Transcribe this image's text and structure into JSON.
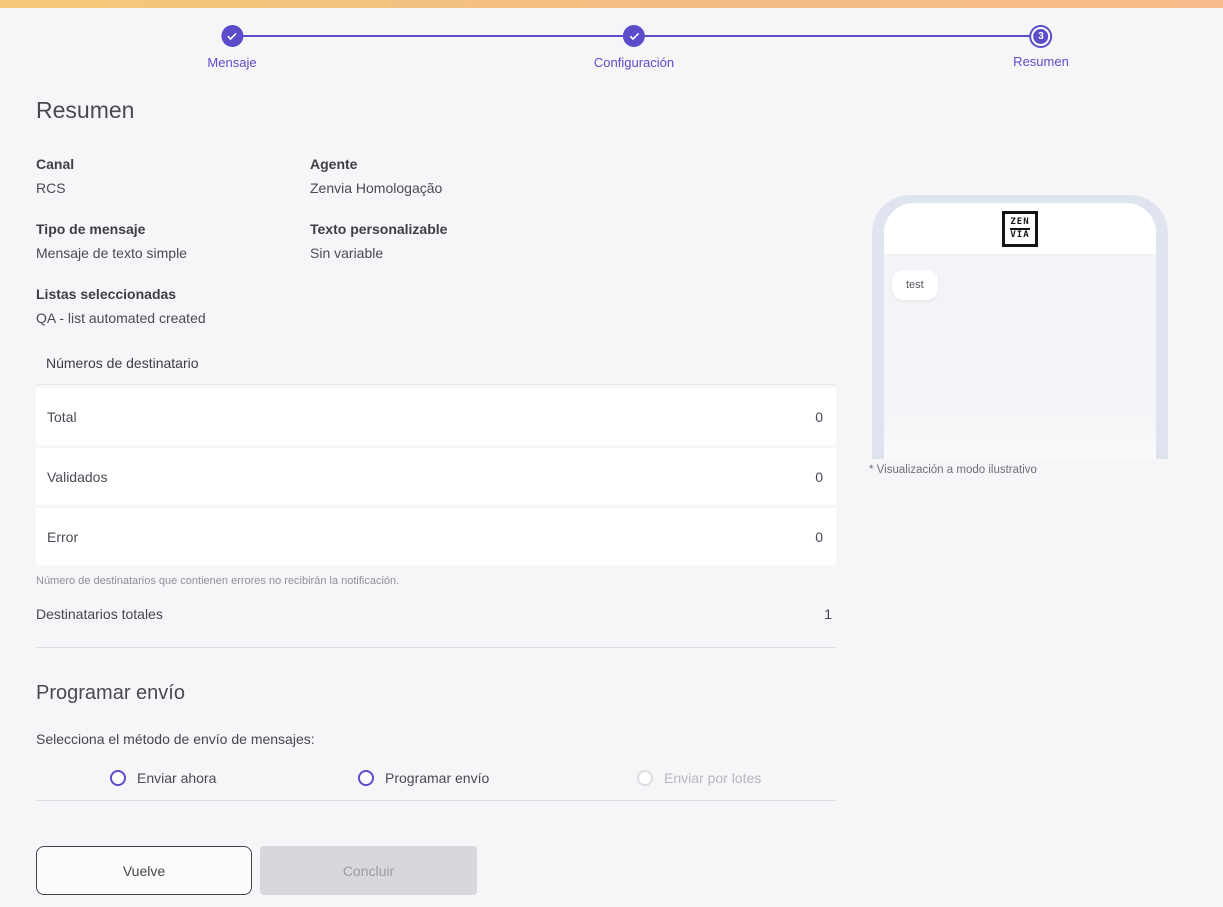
{
  "colors": {
    "accent": "#5b4dc9",
    "topbar_gradient_start": "#f5c979",
    "topbar_gradient_end": "#f8bd8c",
    "disabled_button_bg": "#d6d8db"
  },
  "stepper": {
    "steps": [
      {
        "label": "Mensaje",
        "state": "completed"
      },
      {
        "label": "Configuración",
        "state": "completed"
      },
      {
        "label": "Resumen",
        "state": "current",
        "number": "3"
      }
    ]
  },
  "summary": {
    "title": "Resumen",
    "fields": [
      {
        "label": "Canal",
        "value": "RCS"
      },
      {
        "label": "Agente",
        "value": "Zenvia Homologação"
      },
      {
        "label": "Tipo de mensaje",
        "value": "Mensaje de texto simple"
      },
      {
        "label": "Texto personalizable",
        "value": "Sin variable"
      },
      {
        "label": "Listas seleccionadas",
        "value": "QA - list automated created"
      }
    ],
    "recipients_table": {
      "header": "Números de destinatario",
      "rows": [
        {
          "label": "Total",
          "value": "0"
        },
        {
          "label": "Validados",
          "value": "0"
        },
        {
          "label": "Error",
          "value": "0"
        }
      ],
      "note": "Número de destinatarios que contienen errores no recibirán la notificación.",
      "total_row": {
        "label": "Destinatarios totales",
        "value": "1"
      }
    }
  },
  "schedule": {
    "title": "Programar envío",
    "subtitle": "Selecciona el método de envío de mensajes:",
    "options": [
      {
        "label": "Enviar ahora",
        "disabled": false
      },
      {
        "label": "Programar envío",
        "disabled": false
      },
      {
        "label": "Enviar por lotes",
        "disabled": true
      }
    ]
  },
  "actions": {
    "back_label": "Vuelve",
    "finish_label": "Concluir"
  },
  "preview": {
    "logo_line1": "ZEN",
    "logo_line2": "VIA",
    "bubble_text": "test",
    "note": "* Visualización a modo ilustrativo"
  }
}
